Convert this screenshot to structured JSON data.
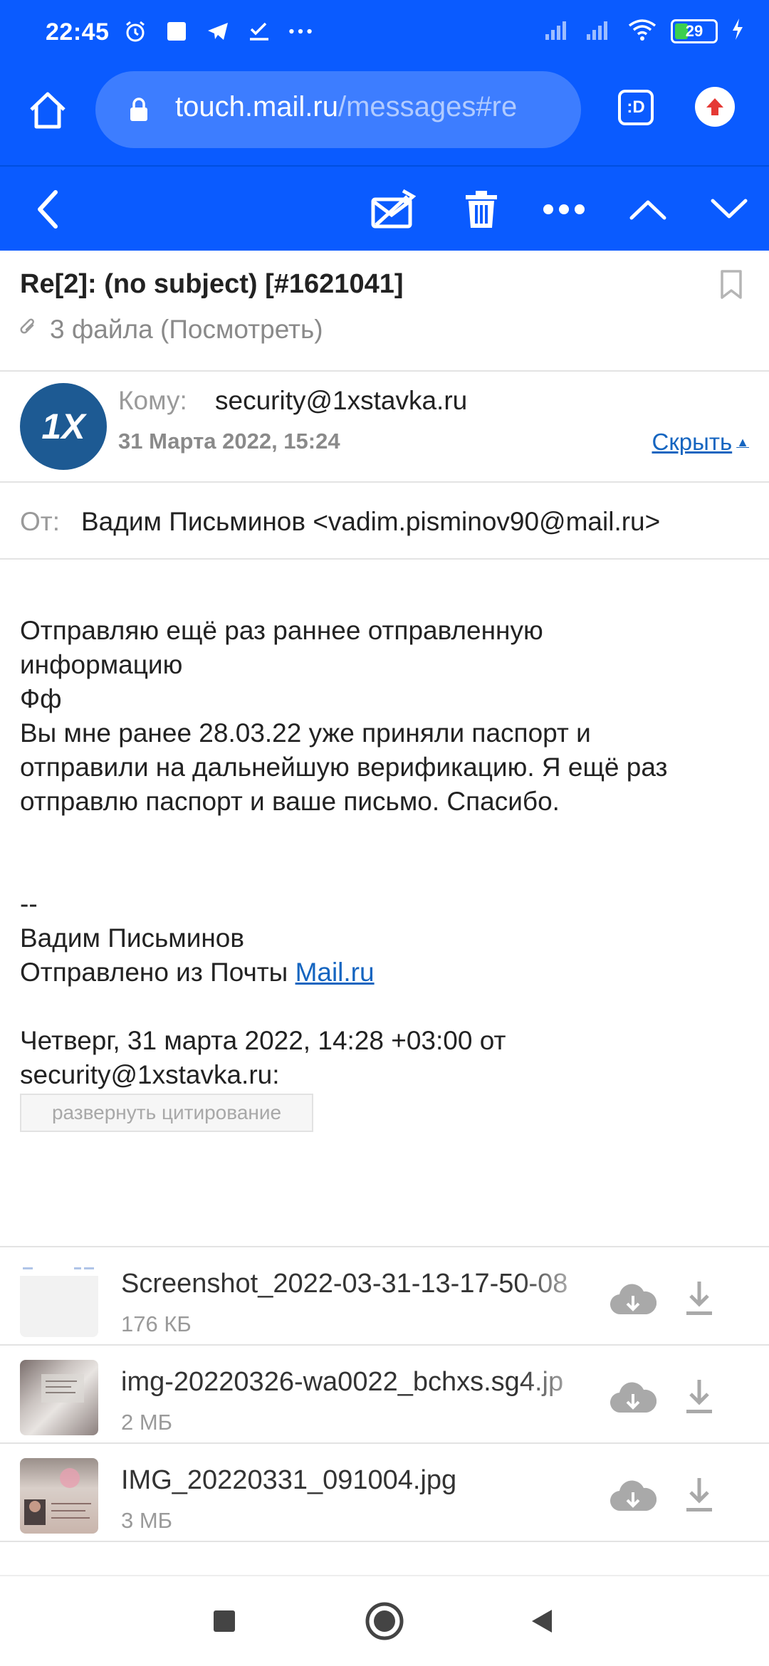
{
  "status_bar": {
    "time": "22:45",
    "battery": "29"
  },
  "browser": {
    "url_host": "touch.mail.ru",
    "url_path": "/messages#re",
    "tabs_label": ":D"
  },
  "message": {
    "subject": "Re[2]: (no subject) [#1621041]",
    "attachments_summary": "3 файла (Посмотреть)",
    "avatar_text": "1X",
    "to_label": "Кому:",
    "to_value": "security@1xstavka.ru",
    "date": "31 Марта 2022, 15:24",
    "hide_label": "Скрыть",
    "from_label": "От:",
    "from_value": "Вадим Письминов <vadim.pisminov90@mail.ru>",
    "body_lines": [
      "Отправляю ещё раз раннее отправленную",
      "информацию",
      "Фф",
      "Вы мне ранее 28.03.22 уже приняли паспорт и",
      "отправили на дальнейшую верификацию. Я ещё раз",
      "отправлю паспорт и ваше письмо. Спасибо."
    ],
    "signature_separator": "--",
    "signature_name": "Вадим Письминов",
    "signature_sent_from": "Отправлено из Почты ",
    "signature_link": "Mail.ru",
    "quote_header_line1": "Четверг, 31 марта 2022, 14:28 +03:00 от",
    "quote_header_line2": "security@1xstavka.ru:",
    "expand_quote_label": "развернуть цитирование"
  },
  "attachments": [
    {
      "name": "Screenshot_2022-03-31-13-17-50-08",
      "size": "176 КБ"
    },
    {
      "name": "img-20220326-wa0022_bchxs.sg4.jp",
      "size": "2 МБ"
    },
    {
      "name": "IMG_20220331_091004.jpg",
      "size": "3 МБ"
    }
  ],
  "colors": {
    "brand_blue": "#0a5bff",
    "link_blue": "#1565c0"
  }
}
